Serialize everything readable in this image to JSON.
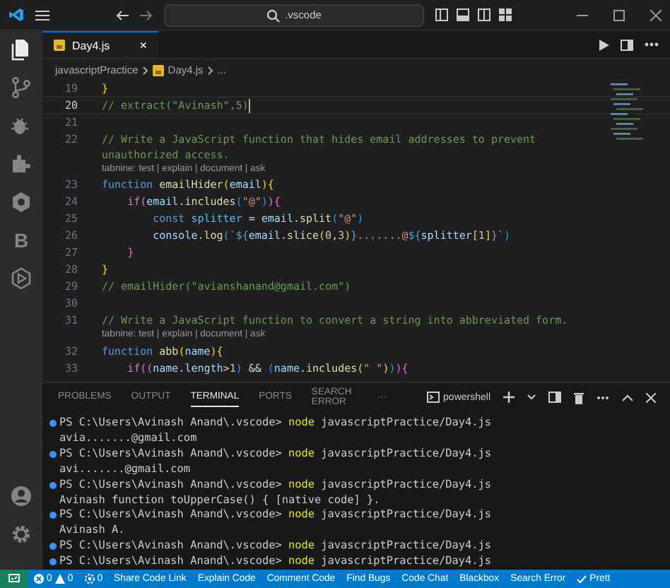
{
  "title_bar": {
    "search": ".vscode"
  },
  "activity_bar": {
    "items": [
      {
        "kind": "files",
        "selected": true
      },
      {
        "kind": "branch",
        "selected": false
      },
      {
        "kind": "bug",
        "selected": false
      },
      {
        "kind": "puzzle",
        "selected": false
      },
      {
        "kind": "tabnine",
        "selected": false
      },
      {
        "kind": "letter",
        "text": "B",
        "selected": false
      },
      {
        "kind": "play",
        "selected": false
      }
    ],
    "bottom": [
      {
        "kind": "account"
      },
      {
        "kind": "gear"
      }
    ]
  },
  "tabs": [
    {
      "label": "Day4.js",
      "close": "×",
      "selected": true
    }
  ],
  "breadcrumb": [
    "javascriptPractice",
    "Day4.js",
    "..."
  ],
  "code_lines": [
    {
      "kind": "code",
      "number": "19",
      "current": false,
      "tokens": [
        {
          "kind": "p1",
          "t": "}"
        }
      ]
    },
    {
      "kind": "code",
      "number": "20",
      "current": true,
      "tokens": [
        {
          "kind": "cm",
          "t": "// extract(\"Avinash\",5)"
        }
      ]
    },
    {
      "kind": "code",
      "number": "21",
      "current": false
    },
    {
      "kind": "code",
      "number": "22",
      "current": false,
      "tokens": [
        {
          "kind": "cm",
          "t": "// Write a JavaScript function that hides email addresses to prevent unauthorized access."
        }
      ]
    },
    {
      "kind": "lens",
      "text": "tabnine: test | explain | document | ask"
    },
    {
      "kind": "code",
      "number": "23",
      "current": false,
      "tokens": [
        {
          "kind": "kw",
          "t": "function "
        },
        {
          "kind": "fn",
          "t": "emailHider"
        },
        {
          "kind": "p1",
          "t": "("
        },
        {
          "kind": "var",
          "t": "email"
        },
        {
          "kind": "p1",
          "t": "){"
        }
      ]
    },
    {
      "kind": "code",
      "number": "24",
      "current": false,
      "tokens": [
        {
          "kind": "ctl",
          "t": "    if"
        },
        {
          "kind": "p2",
          "t": "("
        },
        {
          "kind": "var",
          "t": "email"
        },
        {
          "kind": "op",
          "t": "."
        },
        {
          "kind": "fn",
          "t": "includes"
        },
        {
          "kind": "p3",
          "t": "("
        },
        {
          "kind": "str",
          "t": "\"@\""
        },
        {
          "kind": "p3",
          "t": ")"
        },
        {
          "kind": "p2",
          "t": "){"
        }
      ]
    },
    {
      "kind": "code",
      "number": "25",
      "current": false,
      "tokens": [
        {
          "kind": "kw",
          "t": "        const "
        },
        {
          "kind": "cst",
          "t": "splitter"
        },
        {
          "kind": "op",
          "t": " = "
        },
        {
          "kind": "var",
          "t": "email"
        },
        {
          "kind": "op",
          "t": "."
        },
        {
          "kind": "fn",
          "t": "split"
        },
        {
          "kind": "p3",
          "t": "("
        },
        {
          "kind": "str",
          "t": "\"@\""
        },
        {
          "kind": "p3",
          "t": ")"
        }
      ]
    },
    {
      "kind": "code",
      "number": "26",
      "current": false,
      "tokens": [
        {
          "kind": "var",
          "t": "        console"
        },
        {
          "kind": "op",
          "t": "."
        },
        {
          "kind": "fn",
          "t": "log"
        },
        {
          "kind": "p3",
          "t": "("
        },
        {
          "kind": "str",
          "t": "`"
        },
        {
          "kind": "kw",
          "t": "${"
        },
        {
          "kind": "var",
          "t": "email"
        },
        {
          "kind": "op",
          "t": "."
        },
        {
          "kind": "fn",
          "t": "slice"
        },
        {
          "kind": "p1",
          "t": "("
        },
        {
          "kind": "num",
          "t": "0"
        },
        {
          "kind": "op",
          "t": ","
        },
        {
          "kind": "num",
          "t": "3"
        },
        {
          "kind": "p1",
          "t": ")"
        },
        {
          "kind": "kw",
          "t": "}"
        },
        {
          "kind": "str",
          "t": ".......@"
        },
        {
          "kind": "kw",
          "t": "${"
        },
        {
          "kind": "var",
          "t": "splitter"
        },
        {
          "kind": "p1",
          "t": "["
        },
        {
          "kind": "num",
          "t": "1"
        },
        {
          "kind": "p1",
          "t": "]"
        },
        {
          "kind": "kw",
          "t": "}"
        },
        {
          "kind": "str",
          "t": "`"
        },
        {
          "kind": "p3",
          "t": ")"
        }
      ]
    },
    {
      "kind": "code",
      "number": "27",
      "current": false,
      "tokens": [
        {
          "kind": "p2",
          "t": "    }"
        }
      ]
    },
    {
      "kind": "code",
      "number": "28",
      "current": false,
      "tokens": [
        {
          "kind": "p1",
          "t": "}"
        }
      ]
    },
    {
      "kind": "code",
      "number": "29",
      "current": false,
      "tokens": [
        {
          "kind": "cm",
          "t": "// emailHider(\"avianshanand@gmail.com\")"
        }
      ]
    },
    {
      "kind": "code",
      "number": "30",
      "current": false
    },
    {
      "kind": "code",
      "number": "31",
      "current": false,
      "tokens": [
        {
          "kind": "cm",
          "t": "// Write a JavaScript function to convert a string into abbreviated form."
        }
      ]
    },
    {
      "kind": "lens",
      "text": "tabnine: test | explain | document | ask"
    },
    {
      "kind": "code",
      "number": "32",
      "current": false,
      "tokens": [
        {
          "kind": "kw",
          "t": "function "
        },
        {
          "kind": "fn",
          "t": "abb"
        },
        {
          "kind": "p1",
          "t": "("
        },
        {
          "kind": "var",
          "t": "name"
        },
        {
          "kind": "p1",
          "t": "){"
        }
      ]
    },
    {
      "kind": "code",
      "number": "33",
      "current": false,
      "tokens": [
        {
          "kind": "ctl",
          "t": "    if"
        },
        {
          "kind": "p2",
          "t": "(("
        },
        {
          "kind": "var",
          "t": "name"
        },
        {
          "kind": "op",
          "t": "."
        },
        {
          "kind": "var",
          "t": "length"
        },
        {
          "kind": "op",
          "t": ">"
        },
        {
          "kind": "num",
          "t": "1"
        },
        {
          "kind": "p3",
          "t": ")"
        },
        {
          "kind": "op",
          "t": " && "
        },
        {
          "kind": "p3",
          "t": "("
        },
        {
          "kind": "var",
          "t": "name"
        },
        {
          "kind": "op",
          "t": "."
        },
        {
          "kind": "fn",
          "t": "includes"
        },
        {
          "kind": "p1",
          "t": "("
        },
        {
          "kind": "str",
          "t": "\" \""
        },
        {
          "kind": "p1",
          "t": ")"
        },
        {
          "kind": "p3",
          "t": ")"
        },
        {
          "kind": "p2",
          "t": "){"
        }
      ]
    }
  ],
  "panel": {
    "tabs": [
      {
        "label": "PROBLEMS",
        "selected": false
      },
      {
        "label": "OUTPUT",
        "selected": false
      },
      {
        "label": "TERMINAL",
        "selected": true
      },
      {
        "label": "PORTS",
        "selected": false
      },
      {
        "label": "SEARCH ERROR",
        "selected": false
      }
    ],
    "more": "···",
    "shell": "powershell",
    "terminal": [
      {
        "kind": "prompt",
        "path": "PS C:\\Users\\Avinash Anand\\.vscode>",
        "command": "node",
        "args": "javascriptPractice/Day4.js"
      },
      {
        "kind": "output",
        "text": "avia.......@gmail.com"
      },
      {
        "kind": "prompt",
        "path": "PS C:\\Users\\Avinash Anand\\.vscode>",
        "command": "node",
        "args": "javascriptPractice/Day4.js"
      },
      {
        "kind": "output",
        "text": "avi.......@gmail.com"
      },
      {
        "kind": "prompt",
        "path": "PS C:\\Users\\Avinash Anand\\.vscode>",
        "command": "node",
        "args": "javascriptPractice/Day4.js"
      },
      {
        "kind": "output",
        "text": "Avinash function toUpperCase() { [native code] }."
      },
      {
        "kind": "prompt",
        "path": "PS C:\\Users\\Avinash Anand\\.vscode>",
        "command": "node",
        "args": "javascriptPractice/Day4.js"
      },
      {
        "kind": "output",
        "text": "Avinash A."
      },
      {
        "kind": "prompt",
        "path": "PS C:\\Users\\Avinash Anand\\.vscode>",
        "command": "node",
        "args": "javascriptPractice/Day4.js"
      },
      {
        "kind": "prompt",
        "path": "PS C:\\Users\\Avinash Anand\\.vscode>",
        "command": "node",
        "args": "javascriptPractice/Day4.js"
      }
    ]
  },
  "status_bar": {
    "errors": "0",
    "warnings": "0",
    "ports": "0",
    "items": [
      "Share Code Link",
      "Explain Code",
      "Comment Code",
      "Find Bugs",
      "Code Chat",
      "Blackbox",
      "Search Error",
      "Prett"
    ]
  }
}
